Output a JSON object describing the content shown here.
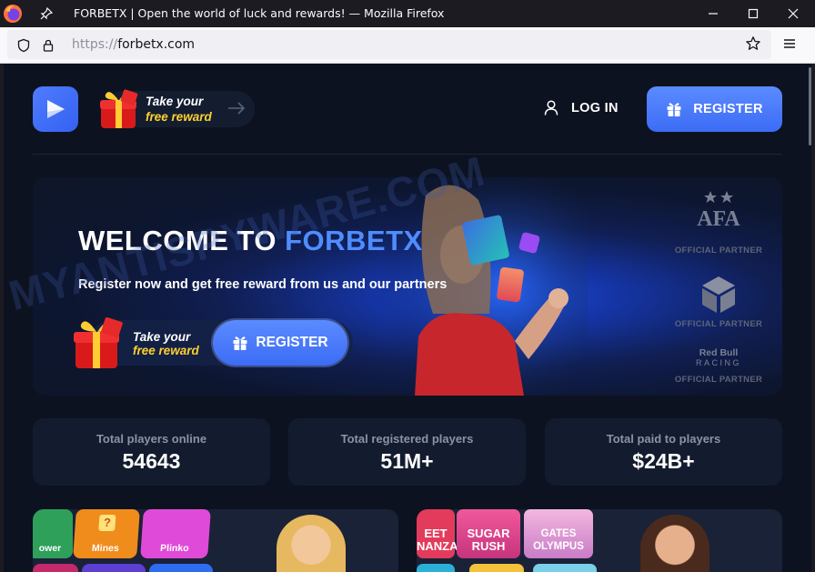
{
  "browser": {
    "window_title": "FORBETX | Open the world of luck and rewards! — Mozilla Firefox",
    "url_scheme": "https://",
    "url_host": "forbetx.com"
  },
  "header": {
    "reward_line1": "Take your",
    "reward_line2": "free reward",
    "login_label": "LOG IN",
    "register_label": "REGISTER"
  },
  "hero": {
    "title_white": "WELCOME TO ",
    "title_blue": "FORBETX",
    "subtitle": "Register now and get free reward from us and our partners",
    "reward_line1": "Take your",
    "reward_line2": "free reward",
    "register_label": "REGISTER"
  },
  "partners": {
    "afa_text": "AFA",
    "caption": "OFFICIAL PARTNER",
    "redbull_line1": "Red Bull",
    "redbull_line2": "RACING"
  },
  "watermark": "MYANTISPYWARE.COM",
  "stats": [
    {
      "label": "Total players online",
      "value": "54643"
    },
    {
      "label": "Total registered players",
      "value": "51M+"
    },
    {
      "label": "Total paid to players",
      "value": "$24B+"
    }
  ],
  "games_left": [
    {
      "label": "ower"
    },
    {
      "label": "Mines"
    },
    {
      "label": "Plinko"
    }
  ],
  "games_right": [
    {
      "label": "EET\nNANZA"
    },
    {
      "label": "SUGAR\nRUSH"
    },
    {
      "label": "GATES\nOLYMPUS"
    }
  ],
  "colors": {
    "accent_blue": "#4f8dff",
    "reward_yellow": "#ffd02e",
    "page_bg": "#0c1220"
  }
}
